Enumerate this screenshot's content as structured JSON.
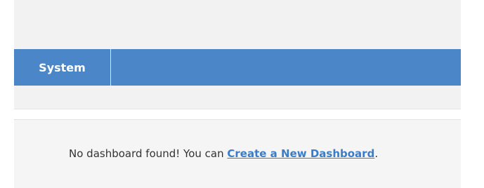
{
  "nav": {
    "tabs": [
      {
        "label": "System"
      }
    ]
  },
  "empty_state": {
    "message_prefix": "No dashboard found! You can ",
    "link_label": "Create a New Dashboard",
    "message_suffix": "."
  },
  "colors": {
    "nav_bar": "#4a86c8",
    "link": "#3a7cc8",
    "panel_background": "#f2f2f2"
  }
}
